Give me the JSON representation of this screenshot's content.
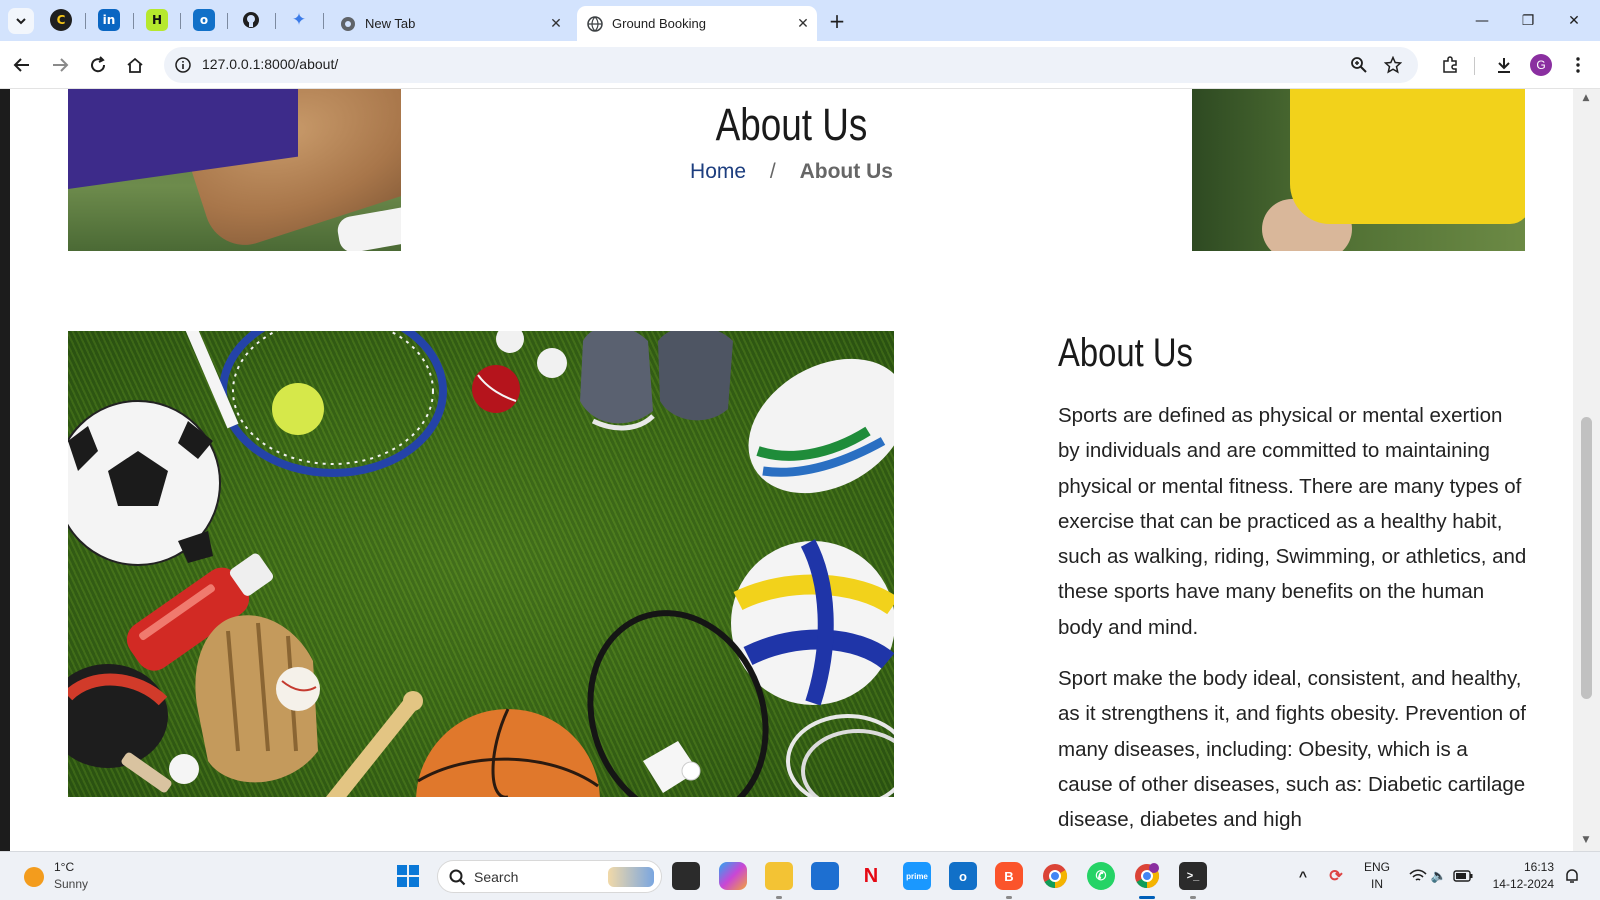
{
  "browser": {
    "tabs": [
      {
        "title": "New Tab",
        "active": false
      },
      {
        "title": "Ground Booking",
        "active": true
      }
    ],
    "address": "127.0.0.1:8000/about/",
    "profile_initial": "G"
  },
  "page": {
    "hero_title": "About Us",
    "breadcrumb": {
      "home": "Home",
      "separator": "/",
      "current": "About Us"
    },
    "section_title": "About Us",
    "paragraphs": [
      "Sports are defined as physical or mental exertion by individuals and are committed to maintaining physical or mental fitness. There are many types of exercise that can be practiced as a healthy habit, such as walking, riding, Swimming, or athletics, and these sports have many benefits on the human body and mind.",
      "Sport make the body ideal, consistent, and healthy, as it strengthens it, and fights obesity. Prevention of many diseases, including: Obesity, which is a cause of other diseases, such as: Diabetic cartilage disease, diabetes and high"
    ]
  },
  "taskbar": {
    "weather": {
      "temp": "1°C",
      "desc": "Sunny"
    },
    "search_label": "Search",
    "lang": {
      "line1": "ENG",
      "line2": "IN"
    },
    "clock": {
      "time": "16:13",
      "date": "14-12-2024"
    }
  },
  "colors": {
    "tab_strip": "#d3e3fd",
    "breadcrumb_link": "#1d3e7f",
    "accent": "#005fb8"
  }
}
